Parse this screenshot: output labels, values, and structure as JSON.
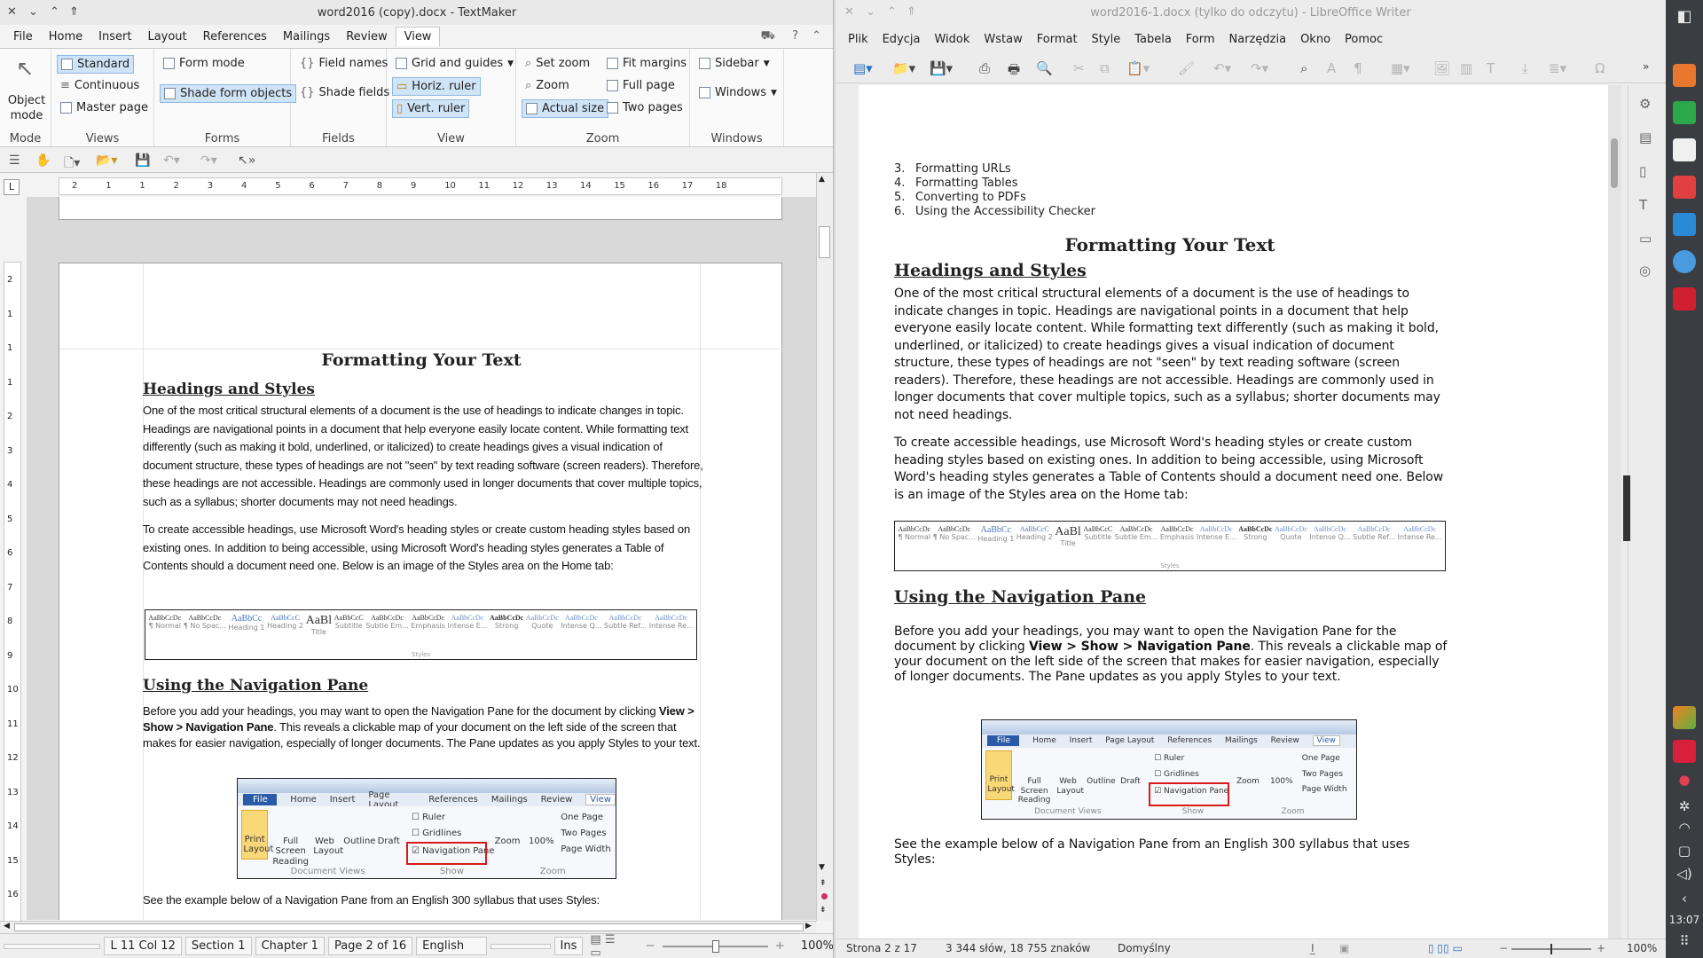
{
  "left_window": {
    "title": "word2016 (copy).docx - TextMaker",
    "menu": [
      "File",
      "Home",
      "Insert",
      "Layout",
      "References",
      "Mailings",
      "Review",
      "View"
    ],
    "active_menu": "View",
    "ribbon": {
      "mode": {
        "label": "Mode",
        "object_mode": "Object mode"
      },
      "views": {
        "label": "Views",
        "standard": "Standard",
        "continuous": "Continuous",
        "master_page": "Master page"
      },
      "forms": {
        "label": "Forms",
        "form_mode": "Form mode",
        "shade_form_objects": "Shade form objects"
      },
      "fields": {
        "label": "Fields",
        "field_names": "Field names",
        "shade_fields": "Shade fields"
      },
      "view": {
        "label": "View",
        "grid_and_guides": "Grid and guides",
        "horiz_ruler": "Horiz. ruler",
        "vert_ruler": "Vert. ruler"
      },
      "zoom": {
        "label": "Zoom",
        "set_zoom": "Set zoom",
        "zoom": "Zoom",
        "actual_size": "Actual size",
        "fit_margins": "Fit margins",
        "full_page": "Full page",
        "two_pages": "Two pages"
      },
      "windows": {
        "label": "Windows",
        "sidebar": "Sidebar",
        "windows": "Windows"
      }
    },
    "ruler_numbers": [
      "2",
      "1",
      "1",
      "2",
      "3",
      "4",
      "5",
      "6",
      "7",
      "8",
      "9",
      "10",
      "11",
      "12",
      "13",
      "14",
      "15",
      "16",
      "17",
      "18"
    ],
    "vruler_numbers": [
      "2",
      "1",
      "1",
      "1",
      "2",
      "3",
      "4",
      "5",
      "6",
      "7",
      "8",
      "9",
      "10",
      "11",
      "12",
      "13",
      "14",
      "15",
      "16"
    ],
    "doc": {
      "title": "Formatting Your Text",
      "h1": "Headings and Styles",
      "p1": "One of the most critical structural elements of a document is the use of headings to indicate changes in topic. Headings are navigational points in a document that help everyone easily locate content. While formatting text differently (such as making it bold, underlined, or italicized) to create headings gives a visual indication of document structure, these types of headings are not \"seen\" by text reading software (screen readers). Therefore, these headings are not accessible. Headings are commonly used in longer documents that cover multiple topics, such as a syllabus; shorter documents may not need headings.",
      "p2": "To create accessible headings, use Microsoft Word's heading styles or create custom heading styles based on existing ones. In addition to being accessible, using Microsoft Word's heading styles generates a Table of Contents should a document need one.  Below is an image of the Styles area on the Home tab:",
      "h2": "Using the Navigation Pane",
      "p3_a": "Before you add your headings, you may want to open the Navigation Pane for the document by clicking ",
      "p3_b": "View > Show > Navigation Pane",
      "p3_c": ". This reveals a clickable map of your document on the left side of the screen that makes for easier navigation, especially of longer documents. The Pane updates as you apply Styles to your text.",
      "p4": "See the example below of a Navigation Pane from an English 300 syllabus that uses Styles:"
    },
    "status": {
      "pos": "L 11 Col 12",
      "section": "Section 1",
      "chapter": "Chapter 1",
      "page": "Page 2 of 16",
      "lang": "English",
      "ins": "Ins",
      "zoom": "100%"
    }
  },
  "styles_strip": {
    "items": [
      {
        "sample": "AaBbCcDc",
        "name": "¶ Normal"
      },
      {
        "sample": "AaBbCcDc",
        "name": "¶ No Spac..."
      },
      {
        "sample": "AaBbCc",
        "name": "Heading 1"
      },
      {
        "sample": "AaBbCcC",
        "name": "Heading 2"
      },
      {
        "sample": "AaBl",
        "name": "Title"
      },
      {
        "sample": "AaBbCcC",
        "name": "Subtitle"
      },
      {
        "sample": "AaBbCcDc",
        "name": "Subtle Em..."
      },
      {
        "sample": "AaBbCcDc",
        "name": "Emphasis"
      },
      {
        "sample": "AaBbCcDc",
        "name": "Intense E..."
      },
      {
        "sample": "AaBbCcDc",
        "name": "Strong"
      },
      {
        "sample": "AaBbCcDc",
        "name": "Quote"
      },
      {
        "sample": "AaBbCcDc",
        "name": "Intense Q..."
      },
      {
        "sample": "AaBbCcDc",
        "name": "Subtle Ref..."
      },
      {
        "sample": "AaBbCcDc",
        "name": "Intense Re..."
      }
    ],
    "caption": "Styles"
  },
  "nav_image": {
    "tabs": [
      "File",
      "Home",
      "Insert",
      "Page Layout",
      "References",
      "Mailings",
      "Review",
      "View"
    ],
    "print_layout": "Print Layout",
    "full_screen": "Full Screen Reading",
    "web_layout": "Web Layout",
    "outline": "Outline",
    "draft": "Draft",
    "ruler": "Ruler",
    "gridlines": "Gridlines",
    "navigation_pane": "Navigation Pane",
    "zoom": "Zoom",
    "hundred": "100%",
    "one_page": "One Page",
    "two_pages": "Two Pages",
    "page_width": "Page Width",
    "doc_views": "Document Views",
    "show": "Show",
    "zoom_group": "Zoom"
  },
  "right_window": {
    "title": "word2016-1.docx (tylko do odczytu) - LibreOffice Writer",
    "menu": [
      "Plik",
      "Edycja",
      "Widok",
      "Wstaw",
      "Format",
      "Style",
      "Tabela",
      "Form",
      "Narzędzia",
      "Okno",
      "Pomoc"
    ],
    "list": [
      {
        "n": "3.",
        "t": "Formatting URLs"
      },
      {
        "n": "4.",
        "t": "Formatting Tables"
      },
      {
        "n": "5.",
        "t": "Converting to PDFs"
      },
      {
        "n": "6.",
        "t": "Using the Accessibility Checker"
      }
    ],
    "status": {
      "page": "Strona 2 z 17",
      "words": "3 344 słów, 18 755 znaków",
      "style": "Domyślny",
      "zoom": "100%"
    }
  },
  "taskbar": {
    "time": "13:07"
  }
}
